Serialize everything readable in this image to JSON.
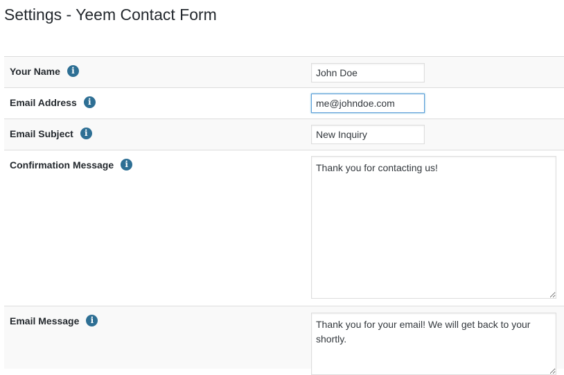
{
  "page": {
    "title": "Settings - Yeem Contact Form"
  },
  "fields": {
    "your_name": {
      "label": "Your Name",
      "value": "John Doe"
    },
    "email_address": {
      "label": "Email Address",
      "value": "me@johndoe.com"
    },
    "email_subject": {
      "label": "Email Subject",
      "value": "New Inquiry"
    },
    "confirmation_message": {
      "label": "Confirmation Message",
      "value": "Thank you for contacting us!"
    },
    "email_message": {
      "label": "Email Message",
      "value": "Thank you for your email! We will get back to your shortly."
    }
  },
  "icons": {
    "info": "i"
  },
  "colors": {
    "info_icon": "#2e6f94",
    "focus_border": "#5b9dd9",
    "row_alt_bg": "#f9f9f9"
  }
}
